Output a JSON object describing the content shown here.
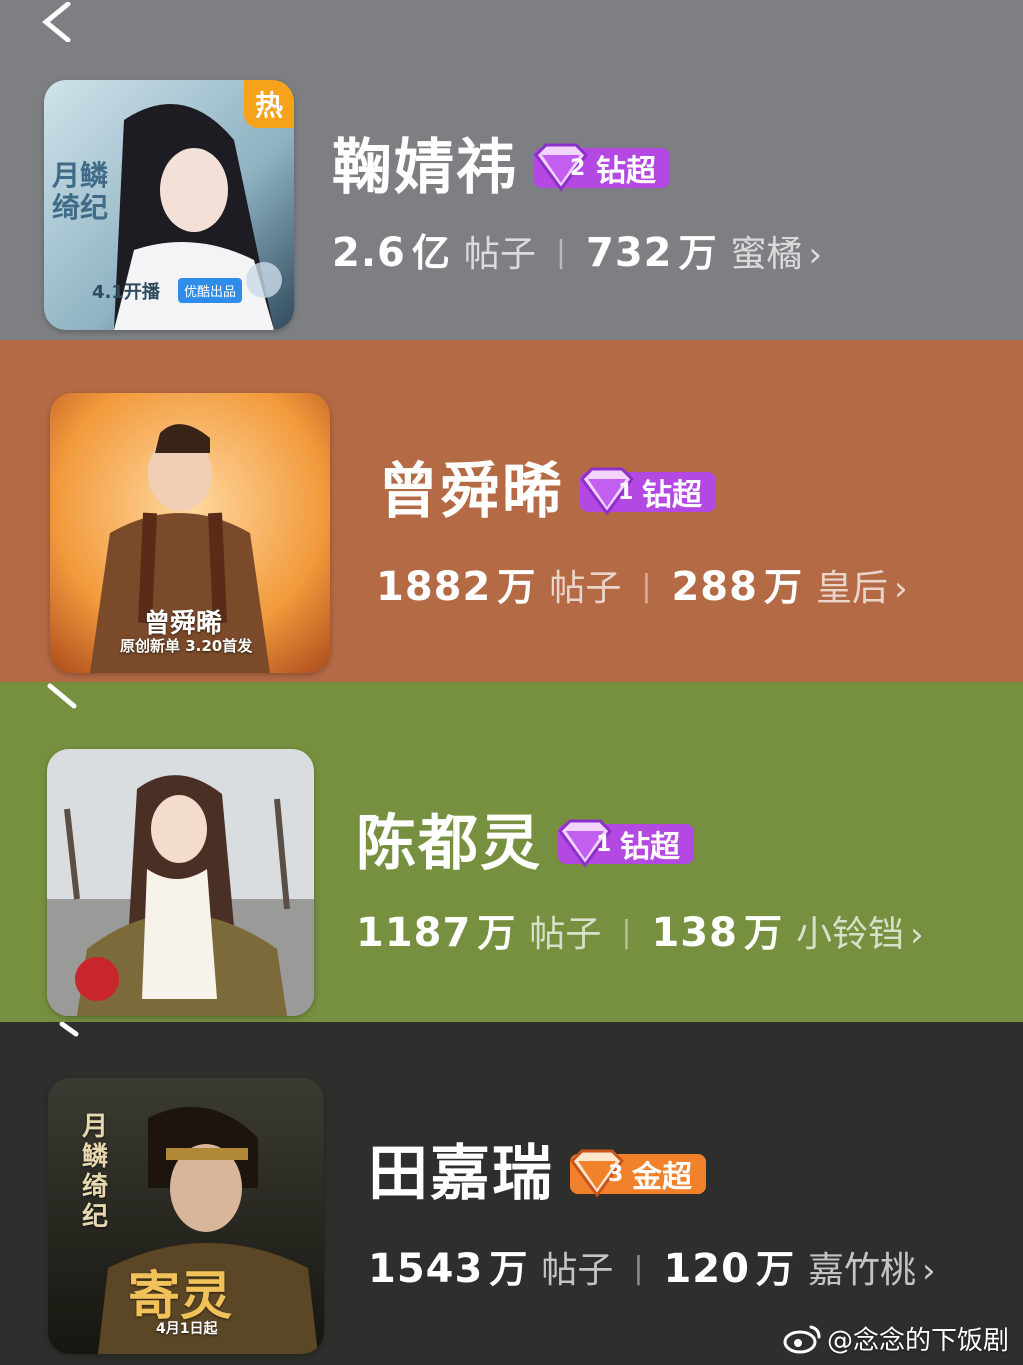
{
  "colors": {
    "panel1": "#7d7f82",
    "panel2": "#b46a45",
    "panel3": "#76903f",
    "panel4": "#2e2e2c",
    "diamond_badge": "#b448e2",
    "gold_badge": "#f2812c"
  },
  "entries": [
    {
      "name": "鞠婧祎",
      "badge_level": "2",
      "badge_label": "钻超",
      "posts_num": "2.6",
      "posts_unit": "亿",
      "posts_label": "帖子",
      "fans_num": "732",
      "fans_unit": "万",
      "fans_label": "蜜橘",
      "cover": {
        "hot": "热",
        "title": "月鳞绮纪",
        "date": "4.1开播",
        "source": "优酷出品"
      }
    },
    {
      "name": "曾舜晞",
      "badge_level": "1",
      "badge_label": "钻超",
      "posts_num": "1882",
      "posts_unit": "万",
      "posts_label": "帖子",
      "fans_num": "288",
      "fans_unit": "万",
      "fans_label": "皇后",
      "cover": {
        "title": "曾舜晞",
        "subtitle": "原创新单 3.20首发"
      }
    },
    {
      "name": "陈都灵",
      "badge_level": "1",
      "badge_label": "钻超",
      "posts_num": "1187",
      "posts_unit": "万",
      "posts_label": "帖子",
      "fans_num": "138",
      "fans_unit": "万",
      "fans_label": "小铃铛"
    },
    {
      "name": "田嘉瑞",
      "badge_level": "3",
      "badge_label": "金超",
      "posts_num": "1543",
      "posts_unit": "万",
      "posts_label": "帖子",
      "fans_num": "120",
      "fans_unit": "万",
      "fans_label": "嘉竹桃",
      "cover": {
        "title": "月鳞绮纪",
        "big": "寄灵",
        "date": "4月1日起"
      }
    }
  ],
  "icons": {
    "back": "chevron-left-icon",
    "more": "chevron-right-icon",
    "gem": "diamond-icon",
    "weibo": "weibo-logo-icon"
  },
  "watermark": "@念念的下饭剧"
}
